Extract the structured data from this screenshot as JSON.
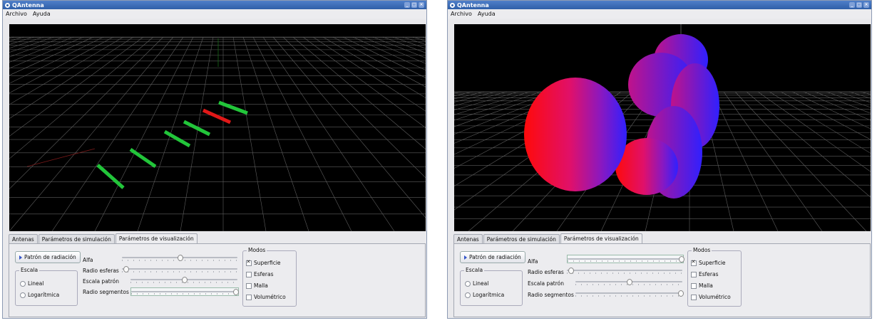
{
  "windows": [
    {
      "id": "left",
      "title": "QAntenna",
      "menu": [
        "Archivo",
        "Ayuda"
      ],
      "tabs": [
        "Antenas",
        "Parámetros de simulación",
        "Parámetros de visualización"
      ],
      "active_tab": 2,
      "panel": {
        "radiation_button": "Patrón de radiación",
        "escala_title": "Escala",
        "escala_options": [
          "Lineal",
          "Logarítmica"
        ],
        "sliders": [
          {
            "label": "Alfa",
            "value": 0.5
          },
          {
            "label": "Radio esferas",
            "value": 0.03
          },
          {
            "label": "Escala patrón",
            "value": 0.5
          },
          {
            "label": "Radio segmentos",
            "value": 0.97
          }
        ],
        "modos_title": "Modos",
        "modos": [
          {
            "label": "Superficie",
            "checked": true
          },
          {
            "label": "Esferas",
            "checked": false
          },
          {
            "label": "Malla",
            "checked": false
          },
          {
            "label": "Volumétrico",
            "checked": false
          }
        ]
      }
    },
    {
      "id": "right",
      "title": "QAntenna",
      "menu": [
        "Archivo",
        "Ayuda"
      ],
      "tabs": [
        "Antenas",
        "Parámetros de simulación",
        "Parámetros de visualización"
      ],
      "active_tab": 2,
      "panel": {
        "radiation_button": "Patrón de radiación",
        "escala_title": "Escala",
        "escala_options": [
          "Lineal",
          "Logarítmica"
        ],
        "sliders": [
          {
            "label": "Alfa",
            "value": 0.98
          },
          {
            "label": "Radio esferas",
            "value": 0.03
          },
          {
            "label": "Escala patrón",
            "value": 0.5
          },
          {
            "label": "Radio segmentos",
            "value": 0.98
          }
        ],
        "modos_title": "Modos",
        "modos": [
          {
            "label": "Superficie",
            "checked": true
          },
          {
            "label": "Esferas",
            "checked": false
          },
          {
            "label": "Malla",
            "checked": false
          },
          {
            "label": "Volumétrico",
            "checked": false
          }
        ]
      }
    }
  ],
  "colors": {
    "titlebar": "#2f5fa8",
    "element_green": "#22c53a",
    "element_active_red": "#e01818",
    "lobe_red": "#ff1010",
    "lobe_blue": "#3020ff"
  }
}
